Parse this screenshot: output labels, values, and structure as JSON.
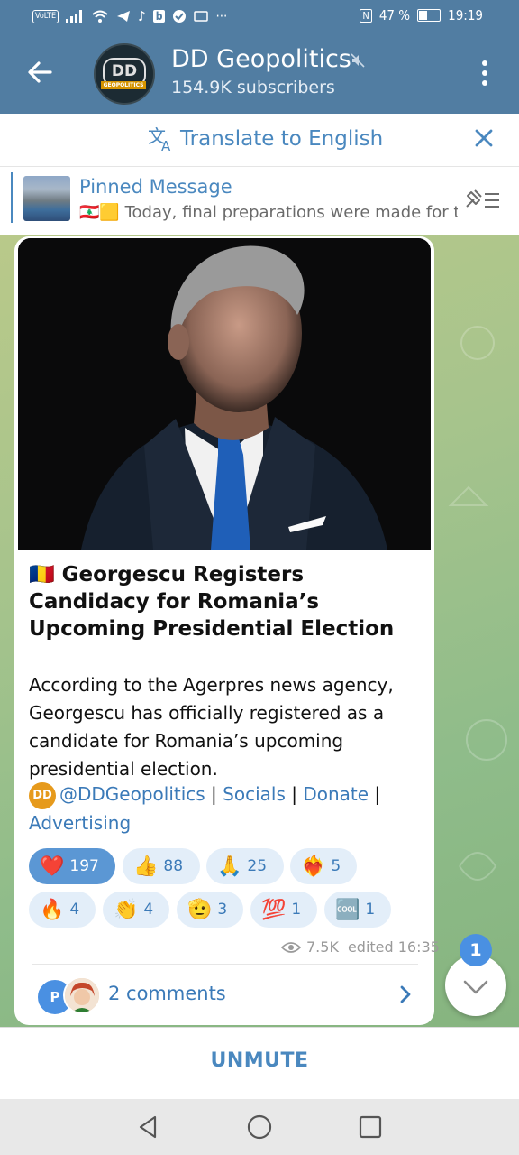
{
  "status_bar": {
    "network": "VoLTE",
    "battery": "47 %",
    "time": "19:19",
    "more": "···"
  },
  "header": {
    "title": "DD Geopolitics",
    "subtitle": "154.9K subscribers",
    "avatar_text": "DD",
    "avatar_band": "GEOPOLITICS"
  },
  "translate": {
    "label": "Translate to English"
  },
  "pinned": {
    "title": "Pinned Message",
    "flags": "🇱🇧🟨",
    "text": "Today, final preparations were made for th..."
  },
  "message": {
    "headline_flag": "🇷🇴",
    "headline": "Georgescu Registers Candidacy for Romania’s Upcoming Presidential Election",
    "body": "According to the Agerpres news agency, Georgescu has officially registered as a candidate for Romania’s upcoming presidential election.",
    "links": {
      "badge": "DD",
      "handle": "@DDGeopolitics",
      "sep1": " | ",
      "socials": "Socials",
      "sep2": " | ",
      "donate": "Donate",
      "sep3": " |",
      "advertising": "Advertising"
    },
    "reactions": [
      {
        "emoji": "❤️",
        "count": "197"
      },
      {
        "emoji": "👍",
        "count": "88"
      },
      {
        "emoji": "🙏",
        "count": "25"
      },
      {
        "emoji": "❤️‍🔥",
        "count": "5"
      },
      {
        "emoji": "🔥",
        "count": "4"
      },
      {
        "emoji": "👏",
        "count": "4"
      },
      {
        "emoji": "🫡",
        "count": "3"
      },
      {
        "emoji": "💯",
        "count": "1"
      },
      {
        "emoji": "🆒",
        "count": "1"
      }
    ],
    "views": "7.5K",
    "edited": "edited 16:35",
    "comments": "2 comments",
    "comment_avatar": "P"
  },
  "scroll_badge": "1",
  "unmute": "UNMUTE",
  "colors": {
    "header": "#517da2",
    "accent": "#4a88bf",
    "reaction_active": "#5b97d4"
  }
}
